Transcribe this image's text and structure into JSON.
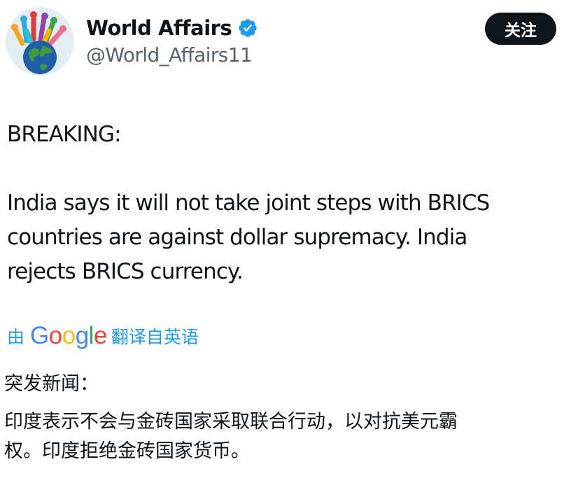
{
  "author": {
    "display_name": "World Affairs",
    "handle": "@World_Affairs11",
    "verified_icon": "verified-badge-icon",
    "avatar_icon": "globe-hands-avatar"
  },
  "follow_label": "关注",
  "tweet": {
    "line1": "BREAKING:",
    "line2": "India says it will not take joint steps with BRICS",
    "line3": "countries are against dollar supremacy. India",
    "line4": "rejects BRICS currency."
  },
  "translate": {
    "prefix": "由",
    "brand": [
      "G",
      "o",
      "o",
      "g",
      "l",
      "e"
    ],
    "suffix": "翻译自英语"
  },
  "translation": {
    "heading": "突发新闻：",
    "body_line1": "印度表示不会与金砖国家采取联合行动，以对抗美元霸",
    "body_line2": "权。印度拒绝金砖国家货币。"
  },
  "colors": {
    "accent": "#1d9bf0",
    "text": "#0f1419",
    "secondary": "#536471",
    "button": "#0f1419"
  }
}
